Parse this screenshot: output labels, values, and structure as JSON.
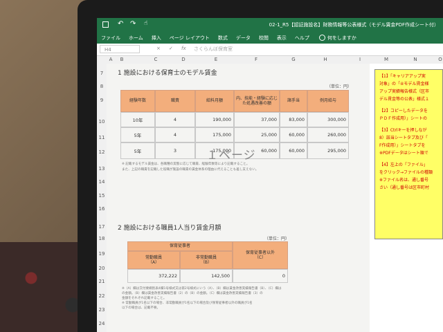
{
  "title_bar": {
    "document_title": "02-1_R5【認証施設名】財務情報等公表様式（モデル賃金PDF作成シート付）"
  },
  "ribbon": {
    "tabs": [
      "ファイル",
      "ホーム",
      "挿入",
      "ページ レイアウト",
      "数式",
      "データ",
      "校閲",
      "表示",
      "ヘルプ"
    ],
    "tell_me": "何をしますか"
  },
  "formula_bar": {
    "name_box": "H4",
    "cancel": "×",
    "enter": "✓",
    "fx": "fx",
    "value": "さくらんぼ保育室"
  },
  "columns": [
    "A",
    "B",
    "C",
    "D",
    "E",
    "F",
    "G",
    "H",
    "I",
    "M",
    "N",
    "O"
  ],
  "rows": [
    "7",
    "8",
    "9",
    "10",
    "11",
    "12",
    "13",
    "14",
    "15",
    "16",
    "17",
    "18",
    "19",
    "20",
    "21",
    "22",
    "23",
    "24",
    "25"
  ],
  "section1": {
    "title": "1 施設における保育士のモデル賃金",
    "unit": "（単位：円）",
    "headers": [
      "経験年数",
      "職責",
      "給料月額",
      "内、技能・経験に応じた処遇改善の額",
      "諸手当",
      "例月給与"
    ],
    "rows": [
      [
        "10年",
        "4",
        "190,000",
        "37,000",
        "83,000",
        "300,000"
      ],
      [
        "5年",
        "4",
        "175,000",
        "25,000",
        "60,000",
        "260,000"
      ],
      [
        "5年",
        "3",
        "175,000",
        "60,000",
        "60,000",
        "295,000"
      ]
    ],
    "notes": [
      "※ 記載するモデル賃金は、各職種の実態に応じて職責、経験年数等により記載すること。",
      "また、上記の職責を記載した役職が施設の職責の賃金体系の理由に代えることも差し支えない。"
    ]
  },
  "page_watermark": "１ページ",
  "section2": {
    "title": "2 施設における職員1人当り賃金月額",
    "unit": "（単位：円）",
    "group_header": "保育従事者",
    "headers": [
      "常勤職員\n（A）",
      "非常勤職員\n（B）",
      "保育従事者以外\n（C）"
    ],
    "values": [
      "372,222",
      "142,500",
      "0"
    ],
    "notes": [
      "※（A）欄は交付要綱別表4欄1号様式又は第2号様式にいう（A）、（B）欄は賃金改善実績報告書（B）、（C）欄は",
      "の金額。（B）欄は賃金改善実績報告書（2）の（B）の金額。（C）欄は賃金改善実績報告書（3）の",
      "金額をそれぞれ記載すること。",
      "※ 常勤職員が1名以下の場合、非常勤職員が1名以下の場合及び保育従事者以外の職員が1名",
      "以下の場合は、記載不要。"
    ]
  },
  "instructions": [
    "【1】「キャリアアップ実",
    "対象」の「④モデル賃金様",
    "アップ実績報告様式（区市",
    "デル賃金等の公表」様式１",
    "【2】コピーしたデータを",
    "ＰＤＦ作成用）」シートの",
    "【3】Ctrlキーを押しなが",
    "8）該当シートタブ及び「",
    "F作成用）」シートタブを",
    "※PDFデータはシート順で",
    "【4】左上の「ファイル」",
    "をクリック→ファイルの種類",
    "※ファイル名は、通し番号",
    "さい（通し番号は区市町村"
  ]
}
